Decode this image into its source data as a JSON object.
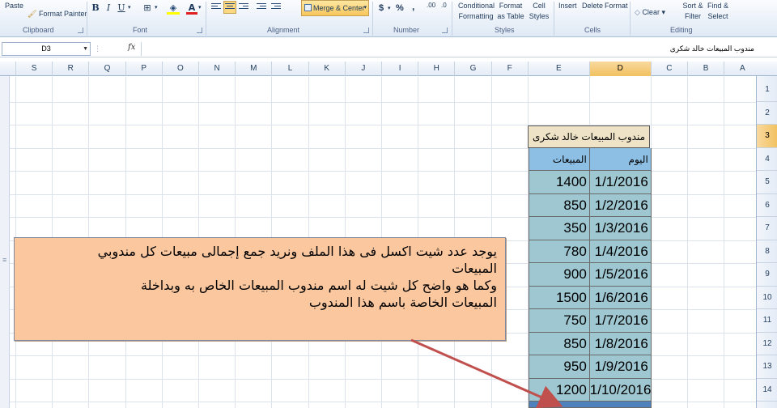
{
  "ribbon": {
    "clipboard": {
      "paste_label": "Paste",
      "format_painter_label": "Format Painter",
      "group_label": "Clipboard"
    },
    "font": {
      "bold": "B",
      "italic": "I",
      "underline": "U",
      "group_label": "Font"
    },
    "alignment": {
      "merge_center_label": "Merge & Center",
      "group_label": "Alignment"
    },
    "number": {
      "currency": "$",
      "percent": "%",
      "comma": ",",
      "inc_decimal": ".00",
      "dec_decimal": ".0",
      "group_label": "Number"
    },
    "styles": {
      "conditional_1": "Conditional",
      "conditional_2": "Formatting",
      "format_1": "Format",
      "format_2": "as Table",
      "cell_1": "Cell",
      "cell_2": "Styles",
      "group_label": "Styles"
    },
    "cells": {
      "insert": "Insert",
      "delete": "Delete",
      "format": "Format",
      "group_label": "Cells"
    },
    "editing": {
      "clear": "Clear",
      "sort_1": "Sort &",
      "sort_2": "Filter",
      "find_1": "Find &",
      "find_2": "Select",
      "group_label": "Editing"
    }
  },
  "formula_bar": {
    "name_box": "D3",
    "fx": "fx",
    "content": "مندوب المبيعات خالد شكرى"
  },
  "columns": [
    "S",
    "R",
    "Q",
    "P",
    "O",
    "N",
    "M",
    "L",
    "K",
    "J",
    "I",
    "H",
    "G",
    "F",
    "E",
    "D",
    "C",
    "B",
    "A"
  ],
  "rows": [
    "1",
    "2",
    "3",
    "4",
    "5",
    "6",
    "7",
    "8",
    "9",
    "10",
    "11",
    "12",
    "13",
    "14"
  ],
  "table": {
    "title": "مندوب المبيعات خالد شكرى",
    "header_date": "اليوم",
    "header_sales": "المبيعات",
    "dates": [
      "1/1/2016",
      "1/2/2016",
      "1/3/2016",
      "1/4/2016",
      "1/5/2016",
      "1/6/2016",
      "1/7/2016",
      "1/8/2016",
      "1/9/2016",
      "1/10/2016"
    ],
    "sales": [
      "1400",
      "850",
      "350",
      "780",
      "900",
      "1500",
      "750",
      "850",
      "950",
      "1200"
    ]
  },
  "callout": {
    "line1": "يوجد عدد شيت اكسل فى هذا الملف ونريد جمع إجمالى مبيعات كل مندوبي",
    "line2": "المبيعات",
    "line3": "وكما هو واضح كل شيت له اسم مندوب المبيعات الخاص به وبداخلة",
    "line4": "المبيعات الخاصة باسم هذا المندوب"
  },
  "colors": {
    "title_fill": "#eee3c6",
    "header_fill": "#8dbfe4",
    "data_fill": "#9ec7d1",
    "callout_fill": "#fbc79f",
    "arrow": "#c0504d",
    "selection": "#f1c15f"
  }
}
